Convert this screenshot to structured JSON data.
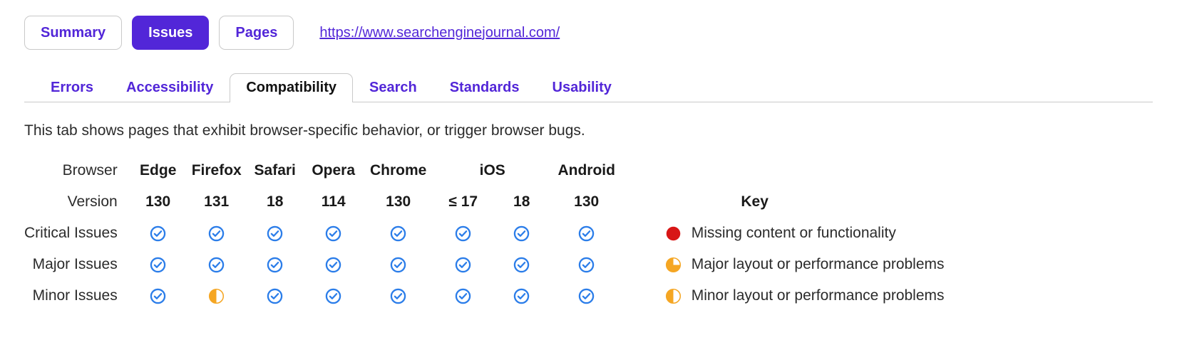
{
  "topbar": {
    "buttons": [
      {
        "label": "Summary",
        "active": false
      },
      {
        "label": "Issues",
        "active": true
      },
      {
        "label": "Pages",
        "active": false
      }
    ],
    "url": "https://www.searchenginejournal.com/"
  },
  "tabs": [
    {
      "label": "Errors",
      "selected": false
    },
    {
      "label": "Accessibility",
      "selected": false
    },
    {
      "label": "Compatibility",
      "selected": true
    },
    {
      "label": "Search",
      "selected": false
    },
    {
      "label": "Standards",
      "selected": false
    },
    {
      "label": "Usability",
      "selected": false
    }
  ],
  "description": "This tab shows pages that exhibit browser-specific behavior, or trigger browser bugs.",
  "table": {
    "browser_row_label": "Browser",
    "version_row_label": "Version",
    "browsers": [
      {
        "name": "Edge",
        "span": 1
      },
      {
        "name": "Firefox",
        "span": 1
      },
      {
        "name": "Safari",
        "span": 1
      },
      {
        "name": "Opera",
        "span": 1
      },
      {
        "name": "Chrome",
        "span": 1
      },
      {
        "name": "iOS",
        "span": 2
      },
      {
        "name": "Android",
        "span": 1
      }
    ],
    "versions": [
      "130",
      "131",
      "18",
      "114",
      "130",
      "≤ 17",
      "18",
      "130"
    ],
    "rows": [
      {
        "label": "Critical Issues",
        "cells": [
          "ok",
          "ok",
          "ok",
          "ok",
          "ok",
          "ok",
          "ok",
          "ok"
        ]
      },
      {
        "label": "Major Issues",
        "cells": [
          "ok",
          "ok",
          "ok",
          "ok",
          "ok",
          "ok",
          "ok",
          "ok"
        ]
      },
      {
        "label": "Minor Issues",
        "cells": [
          "ok",
          "half",
          "ok",
          "ok",
          "ok",
          "ok",
          "ok",
          "ok"
        ]
      }
    ]
  },
  "key": {
    "title": "Key",
    "items": [
      {
        "icon": "full-circle",
        "label": "Missing content or functionality"
      },
      {
        "icon": "three-quarter-circle",
        "label": "Major layout or performance problems"
      },
      {
        "icon": "half-circle",
        "label": "Minor layout or performance problems"
      }
    ]
  },
  "colors": {
    "accent_purple": "#5226d8",
    "check_blue": "#2b7de9",
    "critical_red": "#d81616",
    "warn_orange": "#f5a623",
    "text_dark": "#2b2b2b",
    "border_gray": "#c9c9c9"
  }
}
